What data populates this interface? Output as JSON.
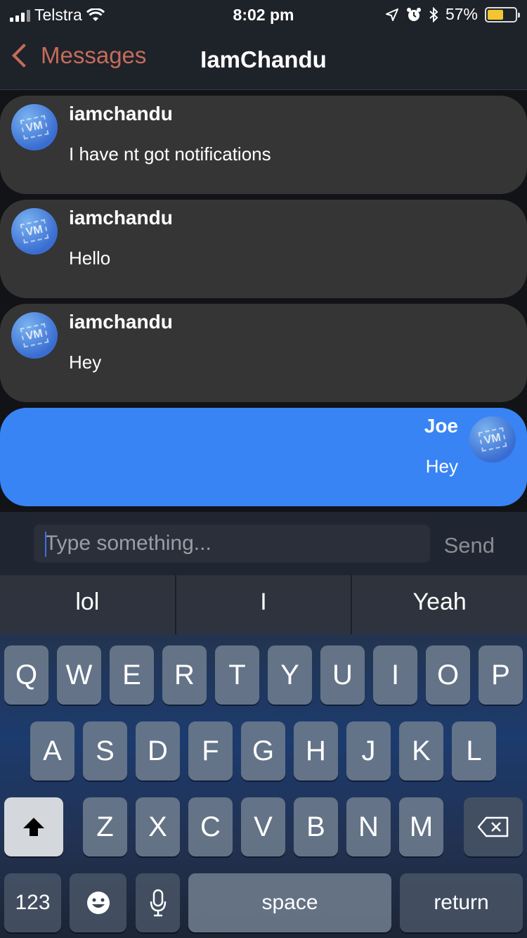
{
  "status_bar": {
    "carrier": "Telstra",
    "time": "8:02 pm",
    "battery_percent": "57%",
    "battery_level": 0.57,
    "icons": [
      "signal-icon",
      "wifi-icon",
      "location-icon",
      "alarm-icon",
      "bluetooth-icon",
      "battery-icon"
    ]
  },
  "nav": {
    "back_label": "Messages",
    "title": "IamChandu"
  },
  "messages": [
    {
      "author": "iamchandu",
      "text": "I have nt got notifications",
      "direction": "incoming",
      "avatar": "VM"
    },
    {
      "author": "iamchandu",
      "text": "Hello",
      "direction": "incoming",
      "avatar": "VM"
    },
    {
      "author": "iamchandu",
      "text": "Hey",
      "direction": "incoming",
      "avatar": "VM"
    },
    {
      "author": "Joe",
      "text": "Hey",
      "direction": "outgoing",
      "avatar": "VM"
    }
  ],
  "composer": {
    "placeholder": "Type something...",
    "send_label": "Send"
  },
  "predictions": [
    "lol",
    "I",
    "Yeah"
  ],
  "keyboard": {
    "row1": [
      "Q",
      "W",
      "E",
      "R",
      "T",
      "Y",
      "U",
      "I",
      "O",
      "P"
    ],
    "row2": [
      "A",
      "S",
      "D",
      "F",
      "G",
      "H",
      "J",
      "K",
      "L"
    ],
    "row3": [
      "Z",
      "X",
      "C",
      "V",
      "B",
      "N",
      "M"
    ],
    "numbers_label": "123",
    "space_label": "space",
    "return_label": "return"
  },
  "colors": {
    "accent_back": "#c56c5a",
    "outgoing_bubble": "#3984f4",
    "incoming_bubble": "#353535"
  }
}
